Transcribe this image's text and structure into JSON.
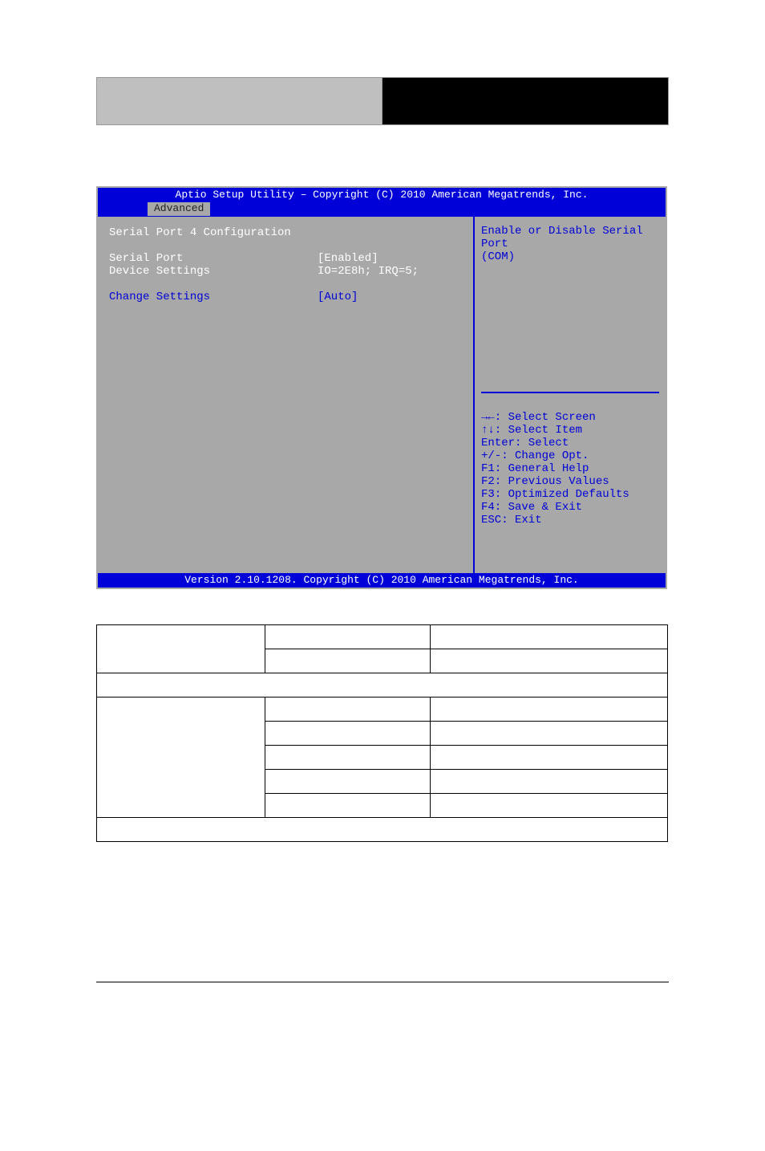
{
  "bios": {
    "title": "Aptio Setup Utility – Copyright (C) 2010 American Megatrends, Inc.",
    "tab": "Advanced",
    "section_title": "Serial Port 4 Configuration",
    "settings": [
      {
        "label": "Serial Port",
        "value": "[Enabled]",
        "label_color": "white",
        "value_color": "white"
      },
      {
        "label": "Device Settings",
        "value": "IO=2E8h; IRQ=5;",
        "label_color": "white",
        "value_color": "white"
      }
    ],
    "settings2": [
      {
        "label": "Change Settings",
        "value": "[Auto]",
        "label_color": "blue",
        "value_color": "blue"
      }
    ],
    "help_text_line1": "Enable or Disable Serial Port",
    "help_text_line2": "(COM)",
    "nav": {
      "l1": "→←: Select Screen",
      "l2": "↑↓: Select Item",
      "l3": "Enter: Select",
      "l4": "+/-: Change Opt.",
      "l5": "F1: General Help",
      "l6": "F2: Previous Values",
      "l7": "F3: Optimized Defaults",
      "l8": "F4: Save & Exit",
      "l9": "ESC: Exit"
    },
    "footer": "Version 2.10.1208. Copyright (C) 2010 American Megatrends, Inc."
  },
  "table": {
    "row1": {
      "c1": "",
      "c2": "",
      "c3": ""
    },
    "row2": {
      "c2": "",
      "c3": ""
    },
    "row3_full": "",
    "row4": {
      "c1": "",
      "c2": "",
      "c3": ""
    },
    "row5": {
      "c2": "",
      "c3": ""
    },
    "row6": {
      "c2": "",
      "c3": ""
    },
    "row7": {
      "c2": "",
      "c3": ""
    },
    "row8": {
      "c2": "",
      "c3": ""
    },
    "row9_full": ""
  }
}
